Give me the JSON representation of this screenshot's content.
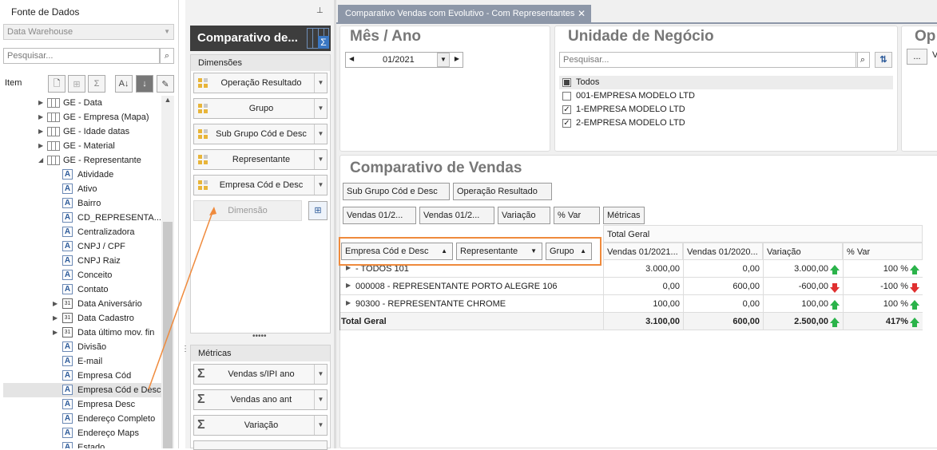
{
  "left_panel": {
    "title": "Fonte de Dados",
    "pin_icon": "pin-icon",
    "datasource": "Data Warehouse",
    "search_placeholder": "Pesquisar...",
    "item_label": "Item",
    "tree": [
      {
        "label": "GE - Data",
        "type": "table",
        "expander": "collapsed",
        "level": 0
      },
      {
        "label": "GE - Empresa (Mapa)",
        "type": "table",
        "expander": "collapsed",
        "level": 0
      },
      {
        "label": "GE - Idade datas",
        "type": "table",
        "expander": "collapsed",
        "level": 0
      },
      {
        "label": "GE - Material",
        "type": "table",
        "expander": "collapsed",
        "level": 0
      },
      {
        "label": "GE - Representante",
        "type": "table",
        "expander": "expanded",
        "level": 0
      },
      {
        "label": "Atividade",
        "type": "text",
        "level": 1
      },
      {
        "label": "Ativo",
        "type": "text",
        "level": 1
      },
      {
        "label": "Bairro",
        "type": "text",
        "level": 1
      },
      {
        "label": "CD_REPRESENTA...",
        "type": "text",
        "level": 1
      },
      {
        "label": "Centralizadora",
        "type": "text",
        "level": 1
      },
      {
        "label": "CNPJ / CPF",
        "type": "text",
        "level": 1
      },
      {
        "label": "CNPJ Raiz",
        "type": "text",
        "level": 1
      },
      {
        "label": "Conceito",
        "type": "text",
        "level": 1
      },
      {
        "label": "Contato",
        "type": "text",
        "level": 1
      },
      {
        "label": "Data Aniversário",
        "type": "date",
        "expander": "collapsed",
        "level": 1
      },
      {
        "label": "Data Cadastro",
        "type": "date",
        "expander": "collapsed",
        "level": 1
      },
      {
        "label": "Data último mov. fin",
        "type": "date",
        "expander": "collapsed",
        "level": 1
      },
      {
        "label": "Divisão",
        "type": "text",
        "level": 1
      },
      {
        "label": "E-mail",
        "type": "text",
        "level": 1
      },
      {
        "label": "Empresa Cód",
        "type": "text",
        "level": 1
      },
      {
        "label": "Empresa Cód e Desc",
        "type": "text",
        "level": 1,
        "highlighted": true
      },
      {
        "label": "Empresa Desc",
        "type": "text",
        "level": 1
      },
      {
        "label": "Endereço Completo",
        "type": "text",
        "level": 1
      },
      {
        "label": "Endereço Maps",
        "type": "text",
        "level": 1
      },
      {
        "label": "Estado",
        "type": "text",
        "level": 1
      }
    ]
  },
  "middle_panel": {
    "title": "Comparativo de...",
    "dimensions_label": "Dimensões",
    "dimensions": [
      "Operação Resultado",
      "Grupo",
      "Sub Grupo Cód e Desc",
      "Representante",
      "Empresa Cód e Desc"
    ],
    "dimension_placeholder": "Dimensão",
    "metrics_label": "Métricas",
    "metrics": [
      "Vendas s/IPI  ano",
      "Vendas ano ant",
      "Variação"
    ]
  },
  "tab": {
    "label": "Comparativo Vendas com Evolutivo - Com Representantes"
  },
  "filters": {
    "mes_ano": {
      "title": "Mês / Ano",
      "value": "01/2021"
    },
    "unidade": {
      "title": "Unidade de Negócio",
      "search_placeholder": "Pesquisar...",
      "items": [
        {
          "label": "Todos",
          "state": "partial"
        },
        {
          "label": "001-EMPRESA MODELO LTD",
          "state": "unchecked"
        },
        {
          "label": "1-EMPRESA MODELO LTD",
          "state": "checked"
        },
        {
          "label": "2-EMPRESA MODELO LTD",
          "state": "checked"
        }
      ]
    },
    "op": {
      "title": "Op",
      "button": "...",
      "partial_text": "V"
    }
  },
  "pivot": {
    "title": "Comparativo de Vendas",
    "filter_fields": [
      "Sub Grupo Cód e Desc",
      "Operação Resultado"
    ],
    "data_fields": [
      "Vendas 01/2...",
      "Vendas 01/2...",
      "Variação",
      "% Var",
      "Métricas"
    ],
    "row_fields": [
      "Empresa Cód e Desc",
      "Representante",
      "Grupo"
    ],
    "total_header": "Total Geral",
    "columns": [
      "Vendas 01/2021...",
      "Vendas 01/2020...",
      "Variação",
      "% Var"
    ],
    "rows": [
      {
        "label": "- TODOS   101",
        "v1": "3.000,00",
        "v2": "0,00",
        "var": "3.000,00",
        "var_dir": "up",
        "pct": "100 %",
        "pct_dir": "up"
      },
      {
        "label": "000008 - REPRESENTANTE PORTO ALEGRE 106",
        "v1": "0,00",
        "v2": "600,00",
        "var": "-600,00",
        "var_dir": "down",
        "pct": "-100 %",
        "pct_dir": "down"
      },
      {
        "label": "90300 - REPRESENTANTE CHROME",
        "v1": "100,00",
        "v2": "0,00",
        "var": "100,00",
        "var_dir": "up",
        "pct": "100 %",
        "pct_dir": "up"
      }
    ],
    "total": {
      "label": "Total Geral",
      "v1": "3.100,00",
      "v2": "600,00",
      "var": "2.500,00",
      "var_dir": "up",
      "pct": "417%",
      "pct_dir": "up"
    }
  },
  "colors": {
    "accent_orange": "#ef8a3c",
    "title_dark": "#3d3d3d",
    "tab_bg": "#8d97a8",
    "up": "#2bb34a",
    "down": "#e03030"
  }
}
